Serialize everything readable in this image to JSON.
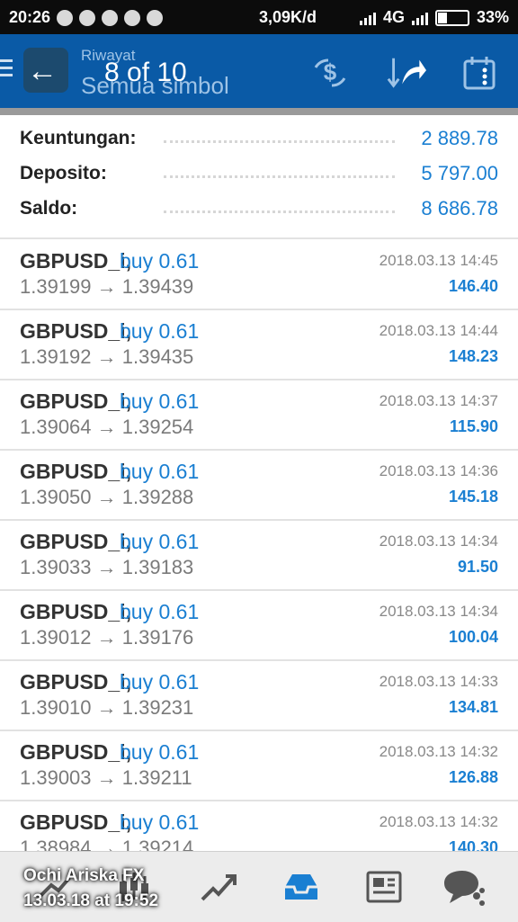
{
  "status_bar": {
    "time": "20:26",
    "network_speed": "3,09K/d",
    "network_type": "4G",
    "battery": "33%"
  },
  "app_bar": {
    "title": "Riwayat",
    "subtitle": "Semua simbol",
    "counter": "8 of 10",
    "icons": [
      "back-arrow-icon",
      "currency-exchange-icon",
      "sort-icon",
      "share-forward-icon",
      "calendar-icon"
    ]
  },
  "summary": {
    "rows": [
      {
        "label": "Keuntungan:",
        "value": "2 889.78"
      },
      {
        "label": "Deposito:",
        "value": "5 797.00"
      },
      {
        "label": "Saldo:",
        "value": "8 686.78"
      }
    ]
  },
  "trades": [
    {
      "symbol": "GBPUSD_i,",
      "direction": "buy 0.61",
      "prices": "1.39199 → 1.39439",
      "time": "2018.03.13 14:45",
      "profit": "146.40"
    },
    {
      "symbol": "GBPUSD_i,",
      "direction": "buy 0.61",
      "prices": "1.39192 → 1.39435",
      "time": "2018.03.13 14:44",
      "profit": "148.23"
    },
    {
      "symbol": "GBPUSD_i,",
      "direction": "buy 0.61",
      "prices": "1.39064 → 1.39254",
      "time": "2018.03.13 14:37",
      "profit": "115.90"
    },
    {
      "symbol": "GBPUSD_i,",
      "direction": "buy 0.61",
      "prices": "1.39050 → 1.39288",
      "time": "2018.03.13 14:36",
      "profit": "145.18"
    },
    {
      "symbol": "GBPUSD_i,",
      "direction": "buy 0.61",
      "prices": "1.39033 → 1.39183",
      "time": "2018.03.13 14:34",
      "profit": "91.50"
    },
    {
      "symbol": "GBPUSD_i,",
      "direction": "buy 0.61",
      "prices": "1.39012 → 1.39176",
      "time": "2018.03.13 14:34",
      "profit": "100.04"
    },
    {
      "symbol": "GBPUSD_i,",
      "direction": "buy 0.61",
      "prices": "1.39010 → 1.39231",
      "time": "2018.03.13 14:33",
      "profit": "134.81"
    },
    {
      "symbol": "GBPUSD_i,",
      "direction": "buy 0.61",
      "prices": "1.39003 → 1.39211",
      "time": "2018.03.13 14:32",
      "profit": "126.88"
    },
    {
      "symbol": "GBPUSD_i,",
      "direction": "buy 0.61",
      "prices": "1.38984 → 1.39214",
      "time": "2018.03.13 14:32",
      "profit": "140.30"
    }
  ],
  "bottom_nav": {
    "items": [
      "quotes-icon",
      "chart-icon",
      "trade-icon",
      "history-icon",
      "news-icon",
      "chat-icon"
    ]
  },
  "overlay": {
    "name": "Ochi Ariska FX",
    "date": "13.03.18 at 19:52"
  },
  "colors": {
    "app_bar": "#0a5aa6",
    "accent_blue": "#1a7fd2",
    "status_bar": "#0c0c0c"
  }
}
